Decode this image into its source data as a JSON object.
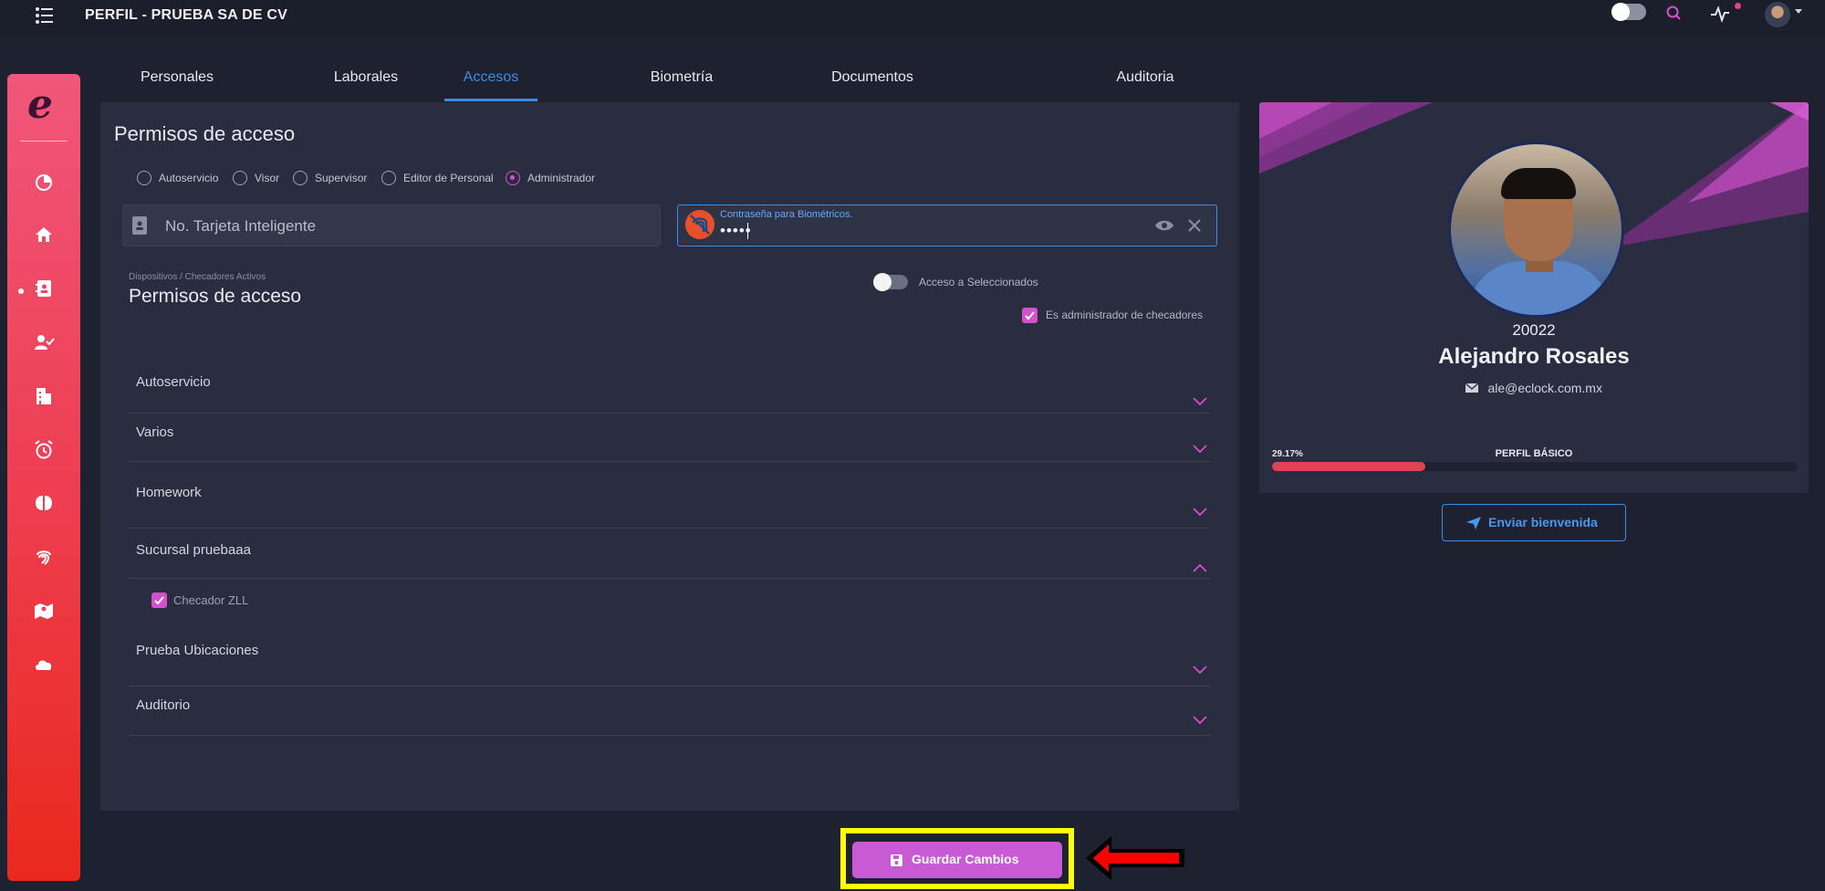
{
  "app": {
    "title": "PERFIL - PRUEBA SA DE CV"
  },
  "header": {
    "icons": [
      "menu-list-icon",
      "theme-toggle",
      "search-icon",
      "activity-icon",
      "user-avatar"
    ]
  },
  "sidebar": {
    "logo": "e",
    "items": [
      "chart-pie-icon",
      "home-icon",
      "contact-card-icon",
      "user-check-icon",
      "building-icon",
      "alarm-clock-icon",
      "brain-icon",
      "fingerprint-icon",
      "map-icon",
      "cloud-icon"
    ],
    "active_index": 2
  },
  "tabs": [
    {
      "label": "Personales"
    },
    {
      "label": "Laborales"
    },
    {
      "label": "Accesos"
    },
    {
      "label": "Biometría"
    },
    {
      "label": "Documentos"
    },
    {
      "label": "Auditoria"
    }
  ],
  "active_tab": "Accesos",
  "access": {
    "title": "Permisos de acceso",
    "roles": [
      {
        "label": "Autoservicio",
        "selected": false
      },
      {
        "label": "Visor",
        "selected": false
      },
      {
        "label": "Supervisor",
        "selected": false
      },
      {
        "label": "Editor de Personal",
        "selected": false
      },
      {
        "label": "Administrador",
        "selected": true
      }
    ],
    "card_field": {
      "placeholder": "No. Tarjeta Inteligente"
    },
    "password_field": {
      "label": "Contraseña para Biométricos.",
      "value": "•••••"
    },
    "breadcrumb": "Dispositivos / Checadores Activos",
    "subtitle": "Permisos de acceso",
    "toggle_label": "Acceso a Seleccionados",
    "admin_checkbox_label": "Es administrador de checadores",
    "groups": [
      {
        "name": "Autoservicio",
        "expanded": false
      },
      {
        "name": "Varios",
        "expanded": false
      },
      {
        "name": "Homework",
        "expanded": false
      },
      {
        "name": "Sucursal pruebaaa",
        "expanded": true,
        "items": [
          {
            "label": "Checador ZLL",
            "checked": true
          }
        ]
      },
      {
        "name": "Prueba Ubicaciones",
        "expanded": false
      },
      {
        "name": "Auditorio",
        "expanded": false
      }
    ]
  },
  "profile": {
    "id": "20022",
    "name": "Alejandro Rosales",
    "email": "ale@eclock.com.mx",
    "progress_percent": 29.17,
    "progress_text": "29.17%",
    "progress_label": "PERFIL BÁSICO",
    "welcome_button": "Enviar bienvenida"
  },
  "actions": {
    "save_label": "Guardar Cambios"
  },
  "colors": {
    "accent_blue": "#3a8ee6",
    "accent_magenta": "#d64fcd",
    "save_button": "#c85ad3",
    "progress": "#e34255",
    "highlight": "#ffff00",
    "arrow": "#ff0000"
  }
}
